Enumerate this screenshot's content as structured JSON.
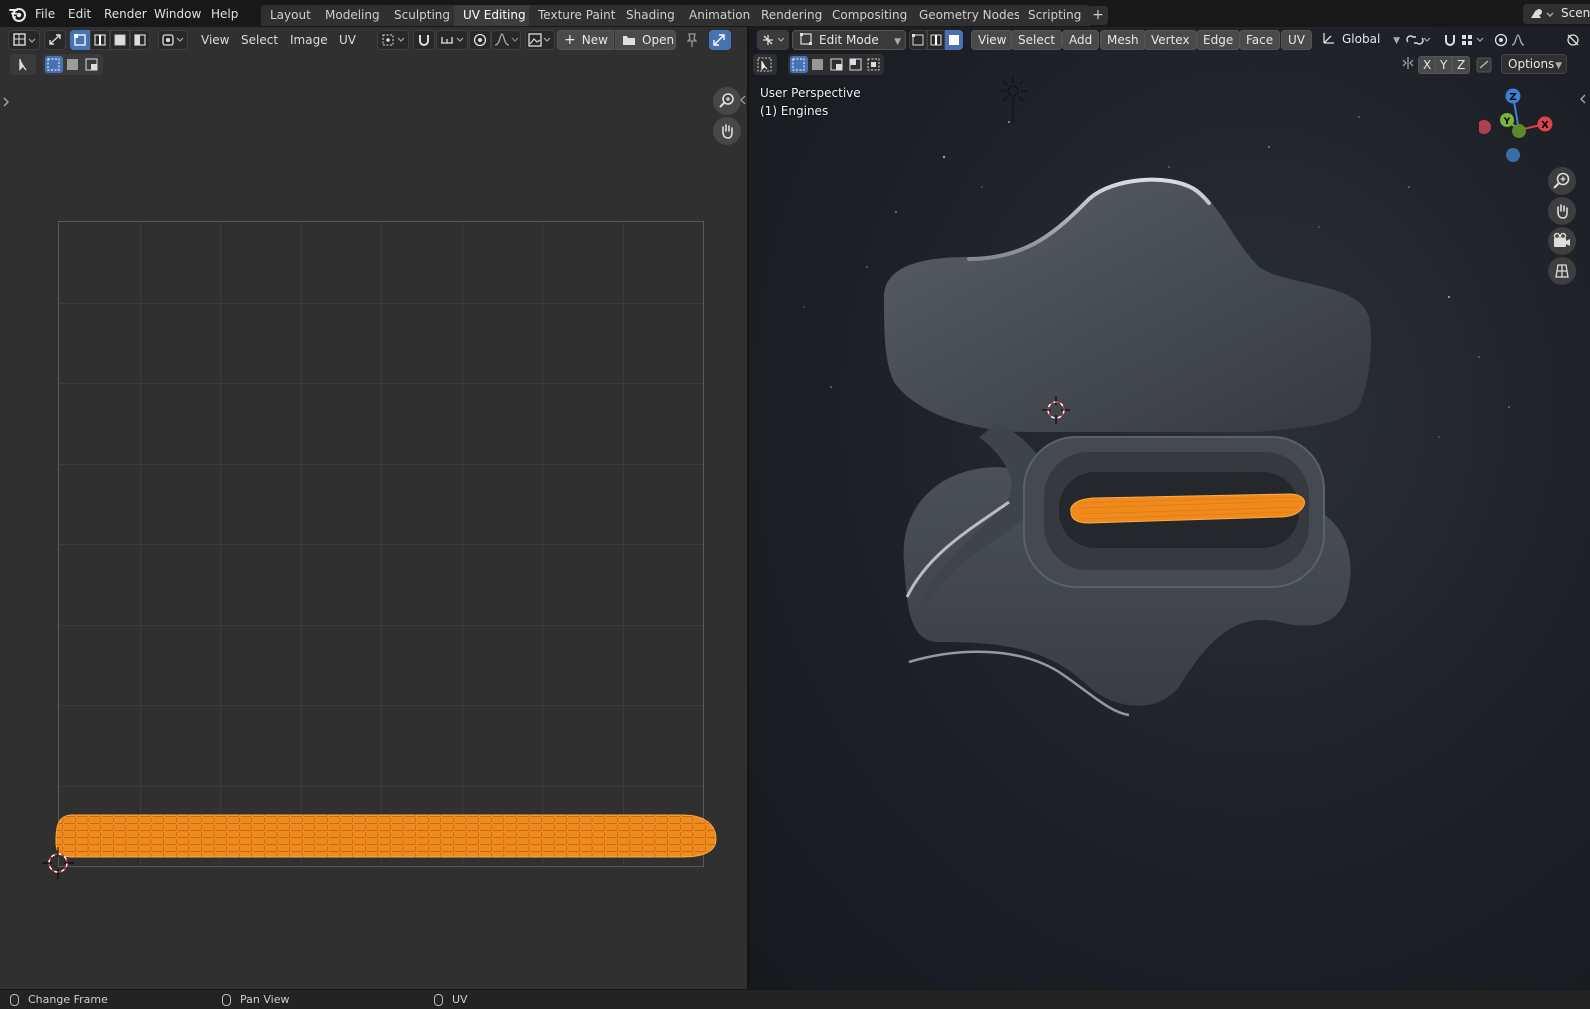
{
  "menus": [
    "File",
    "Edit",
    "Render",
    "Window",
    "Help"
  ],
  "workspaces": [
    "Layout",
    "Modeling",
    "Sculpting",
    "UV Editing",
    "Texture Paint",
    "Shading",
    "Animation",
    "Rendering",
    "Compositing",
    "Geometry Nodes",
    "Scripting"
  ],
  "active_workspace": "UV Editing",
  "scene_label": "Scene",
  "uv_editor": {
    "menus": [
      "View",
      "Select",
      "Image",
      "UV"
    ],
    "new_label": "New",
    "open_label": "Open"
  },
  "viewport": {
    "mode_label": "Edit Mode",
    "menus": [
      "View",
      "Select",
      "Add",
      "Mesh",
      "Vertex",
      "Edge",
      "Face",
      "UV"
    ],
    "transform_orientation": "Global",
    "options_label": "Options",
    "axis_x": "X",
    "axis_y": "Y",
    "axis_z": "Z",
    "perspective_label": "User Perspective",
    "object_label": "(1) Engines",
    "gizmo": {
      "x": "X",
      "y": "Y",
      "z": "Z"
    }
  },
  "status": {
    "left": "Change Frame",
    "middle": "Pan View",
    "right": "UV"
  },
  "colors": {
    "accent": "#4772b3",
    "selection": "#f08a1c",
    "axis_x": "#e0424b",
    "axis_y": "#7ab43a",
    "axis_z": "#3b82d6"
  }
}
